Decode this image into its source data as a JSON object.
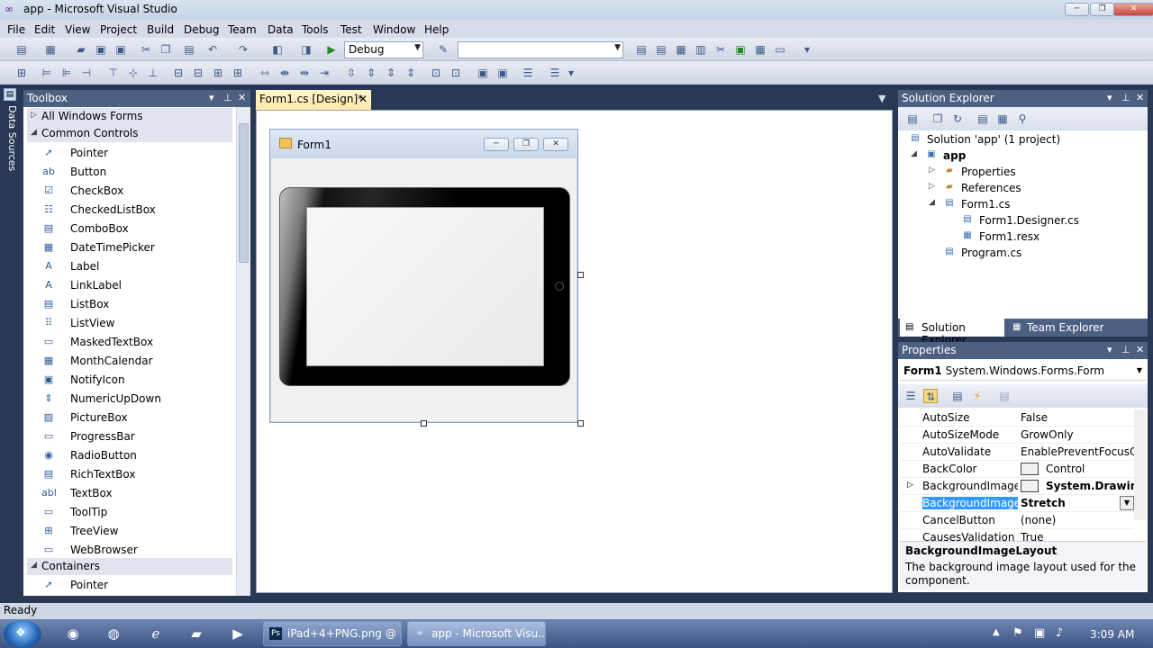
{
  "window": {
    "title": "app - Microsoft Visual Studio",
    "min": "─",
    "max": "❐",
    "close": "✕"
  },
  "menu": [
    "File",
    "Edit",
    "View",
    "Project",
    "Build",
    "Debug",
    "Team",
    "Data",
    "Tools",
    "Test",
    "Window",
    "Help"
  ],
  "toolbar": {
    "config_combo": "Debug",
    "platform_combo": ""
  },
  "left_tab": "Data Sources",
  "toolbox": {
    "title": "Toolbox",
    "groups": [
      {
        "label": "All Windows Forms",
        "expanded": false
      },
      {
        "label": "Common Controls",
        "expanded": true
      },
      {
        "label": "Containers",
        "expanded": true
      }
    ],
    "items": [
      {
        "label": "Pointer",
        "icon": "pointer-icon",
        "glyph": "➚"
      },
      {
        "label": "Button",
        "icon": "button-icon",
        "glyph": "ab"
      },
      {
        "label": "CheckBox",
        "icon": "checkbox-icon",
        "glyph": "☑"
      },
      {
        "label": "CheckedListBox",
        "icon": "checkedlistbox-icon",
        "glyph": "☷"
      },
      {
        "label": "ComboBox",
        "icon": "combobox-icon",
        "glyph": "▤"
      },
      {
        "label": "DateTimePicker",
        "icon": "datetimepicker-icon",
        "glyph": "▦"
      },
      {
        "label": "Label",
        "icon": "label-icon",
        "glyph": "A"
      },
      {
        "label": "LinkLabel",
        "icon": "linklabel-icon",
        "glyph": "A"
      },
      {
        "label": "ListBox",
        "icon": "listbox-icon",
        "glyph": "▤"
      },
      {
        "label": "ListView",
        "icon": "listview-icon",
        "glyph": "⠿"
      },
      {
        "label": "MaskedTextBox",
        "icon": "maskedtextbox-icon",
        "glyph": "▭"
      },
      {
        "label": "MonthCalendar",
        "icon": "monthcalendar-icon",
        "glyph": "▦"
      },
      {
        "label": "NotifyIcon",
        "icon": "notifyicon-icon",
        "glyph": "▣"
      },
      {
        "label": "NumericUpDown",
        "icon": "numericupdown-icon",
        "glyph": "⇕"
      },
      {
        "label": "PictureBox",
        "icon": "picturebox-icon",
        "glyph": "▨"
      },
      {
        "label": "ProgressBar",
        "icon": "progressbar-icon",
        "glyph": "▭"
      },
      {
        "label": "RadioButton",
        "icon": "radiobutton-icon",
        "glyph": "◉"
      },
      {
        "label": "RichTextBox",
        "icon": "richtextbox-icon",
        "glyph": "▤"
      },
      {
        "label": "TextBox",
        "icon": "textbox-icon",
        "glyph": "abl"
      },
      {
        "label": "ToolTip",
        "icon": "tooltip-icon",
        "glyph": "▭"
      },
      {
        "label": "TreeView",
        "icon": "treeview-icon",
        "glyph": "⊞"
      },
      {
        "label": "WebBrowser",
        "icon": "webbrowser-icon",
        "glyph": "▭"
      }
    ],
    "containers_items": [
      {
        "label": "Pointer",
        "icon": "pointer-icon",
        "glyph": "➚"
      }
    ]
  },
  "document": {
    "tab": "Form1.cs [Design]*",
    "form_title": "Form1"
  },
  "solution_explorer": {
    "title": "Solution Explorer",
    "tree": [
      {
        "label": "Solution 'app' (1 project)",
        "level": 0,
        "icon": "solution-icon",
        "bold": false,
        "expander": ""
      },
      {
        "label": "app",
        "level": 1,
        "icon": "project-icon",
        "bold": true,
        "expander": "◢"
      },
      {
        "label": "Properties",
        "level": 2,
        "icon": "folder-icon",
        "bold": false,
        "expander": "▷"
      },
      {
        "label": "References",
        "level": 2,
        "icon": "folder-icon",
        "bold": false,
        "expander": "▷"
      },
      {
        "label": "Form1.cs",
        "level": 2,
        "icon": "form-icon",
        "bold": false,
        "expander": "◢"
      },
      {
        "label": "Form1.Designer.cs",
        "level": 3,
        "icon": "cs-file-icon",
        "bold": false,
        "expander": ""
      },
      {
        "label": "Form1.resx",
        "level": 3,
        "icon": "resx-file-icon",
        "bold": false,
        "expander": ""
      },
      {
        "label": "Program.cs",
        "level": 2,
        "icon": "cs-file-icon",
        "bold": false,
        "expander": ""
      }
    ],
    "tabs": [
      "Solution Explorer",
      "Team Explorer"
    ]
  },
  "properties": {
    "title": "Properties",
    "object_name": "Form1",
    "object_type": "System.Windows.Forms.Form",
    "rows": [
      {
        "name": "AutoSize",
        "value": "False",
        "bold": false,
        "swatch": false,
        "expander": false,
        "selected": false
      },
      {
        "name": "AutoSizeMode",
        "value": "GrowOnly",
        "bold": false,
        "swatch": false,
        "expander": false,
        "selected": false
      },
      {
        "name": "AutoValidate",
        "value": "EnablePreventFocusChange",
        "bold": false,
        "swatch": false,
        "expander": false,
        "selected": false
      },
      {
        "name": "BackColor",
        "value": "Control",
        "bold": false,
        "swatch": true,
        "expander": false,
        "selected": false
      },
      {
        "name": "BackgroundImage",
        "value": "System.Drawing.",
        "bold": true,
        "swatch": true,
        "expander": true,
        "selected": false
      },
      {
        "name": "BackgroundImageLayout",
        "value": "Stretch",
        "bold": true,
        "swatch": false,
        "expander": false,
        "selected": true
      },
      {
        "name": "CancelButton",
        "value": "(none)",
        "bold": false,
        "swatch": false,
        "expander": false,
        "selected": false
      },
      {
        "name": "CausesValidation",
        "value": "True",
        "bold": false,
        "swatch": false,
        "expander": false,
        "selected": false
      }
    ],
    "desc_name": "BackgroundImageLayout",
    "desc_text": "The background image layout used for the component."
  },
  "status": "Ready",
  "taskbar": {
    "tasks": [
      {
        "label": "iPad+4+PNG.png @ ...",
        "icon": "photoshop-icon",
        "glyph": "Ps"
      },
      {
        "label": "app - Microsoft Visu...",
        "icon": "visual-studio-icon",
        "glyph": "∞"
      }
    ],
    "clock": "3:09 AM"
  }
}
